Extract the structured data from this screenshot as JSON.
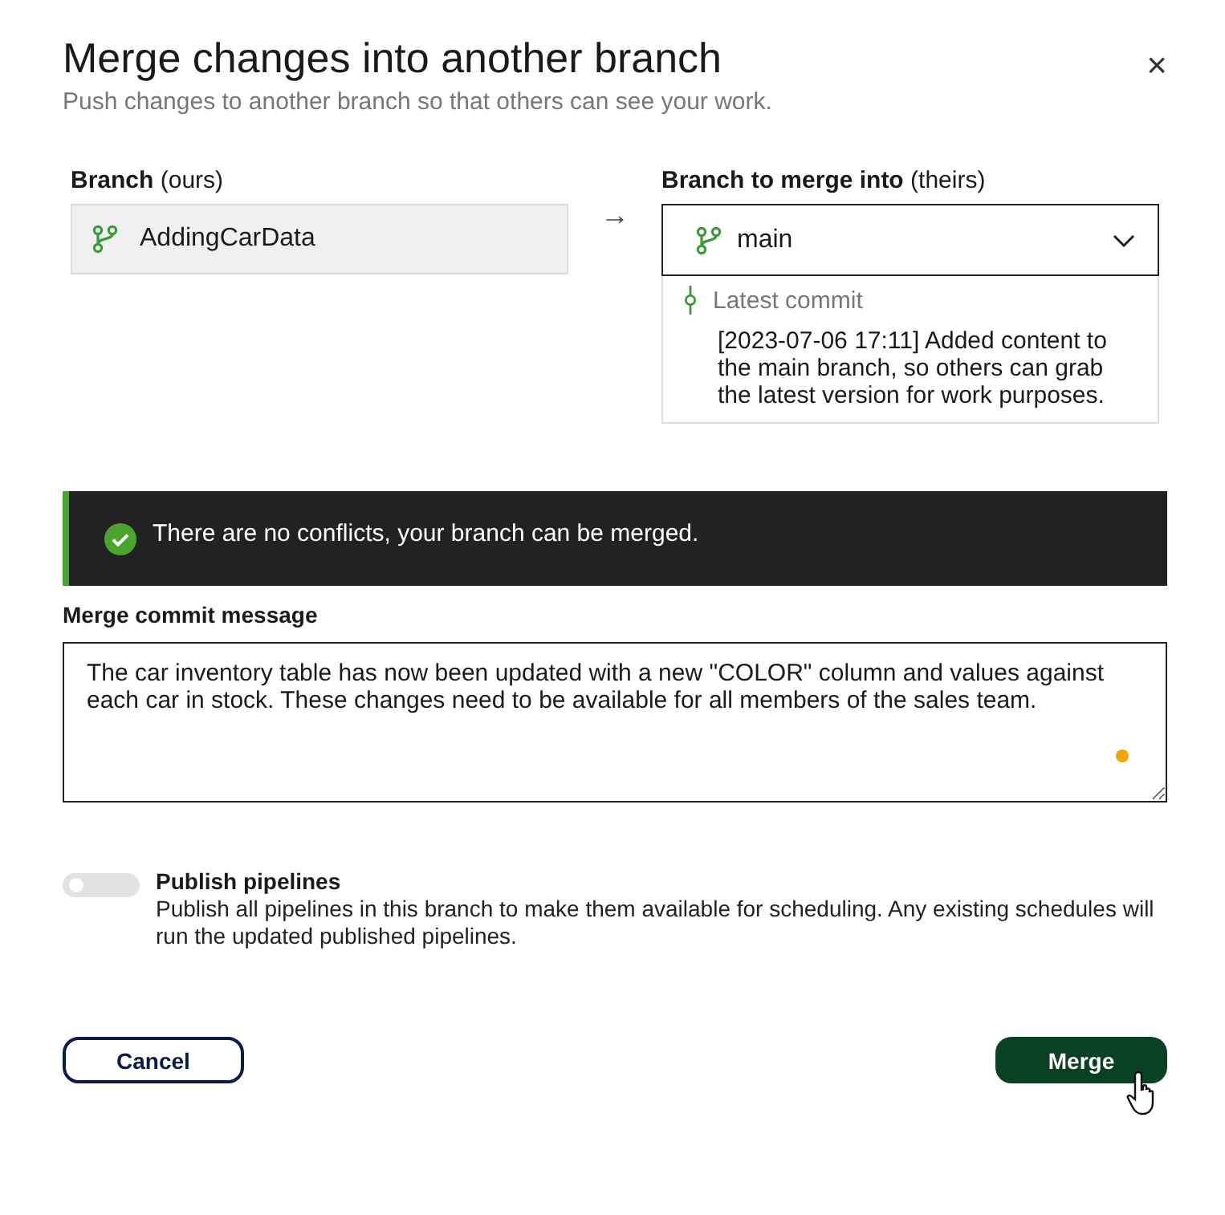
{
  "dialog": {
    "title": "Merge changes into another branch",
    "subtitle": "Push changes to another branch so that others can see your work.",
    "close": "×"
  },
  "source": {
    "label": "**Branch** (ours)",
    "branch": "AddingCarData"
  },
  "arrow": "→",
  "target": {
    "label": "**Branch to merge into** (theirs)",
    "branch": "main",
    "expanded": true,
    "commit_heading": "Latest commit",
    "commit_text": "[2023-07-06 17:11] Added content to the main branch, so others can grab the latest version for work purposes."
  },
  "banner": {
    "has_conflicts": false,
    "text": "There are no conflicts, your branch can be merged."
  },
  "message": {
    "label": "Merge commit message",
    "value": "The car inventory table has now been updated with a new \"COLOR\" column and values against each car in stock. These changes need to be available for all members of the sales team."
  },
  "publish": {
    "on": false,
    "title": "Publish pipelines",
    "description": "Publish all pipelines in this branch to make them available for scheduling. Any existing schedules will run the updated published pipelines."
  },
  "buttons": [
    {
      "kind": "secondary",
      "label": "Cancel"
    },
    {
      "kind": "primary",
      "label": "Merge"
    }
  ]
}
